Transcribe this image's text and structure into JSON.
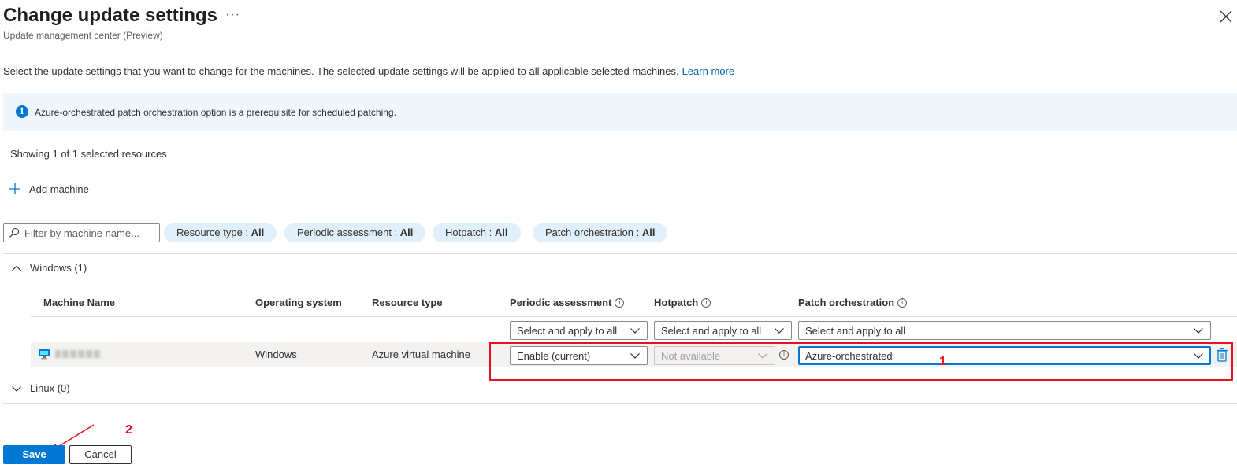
{
  "header": {
    "title": "Change update settings",
    "more": "···",
    "subtitle": "Update management center (Preview)",
    "close_icon": "close-icon"
  },
  "description": {
    "text": "Select the update settings that you want to change for the machines. The selected update settings will be applied to all applicable selected machines.",
    "link": "Learn more"
  },
  "info_bar": {
    "icon": "info-icon",
    "glyph": "i",
    "text": "Azure-orchestrated patch orchestration option is a prerequisite for scheduled patching."
  },
  "showing": "Showing 1 of 1 selected resources",
  "add_machine": {
    "icon": "plus-icon",
    "label": "Add machine"
  },
  "filter": {
    "placeholder": "Filter by machine name...",
    "pills": [
      {
        "label": "Resource type : ",
        "value": "All"
      },
      {
        "label": "Periodic assessment : ",
        "value": "All"
      },
      {
        "label": "Hotpatch : ",
        "value": "All"
      },
      {
        "label": "Patch orchestration : ",
        "value": "All"
      }
    ]
  },
  "groups": {
    "windows": "Windows (1)",
    "linux": "Linux (0)"
  },
  "columns": {
    "machine_name": "Machine Name",
    "os": "Operating system",
    "resource_type": "Resource type",
    "periodic_assessment": "Periodic assessment",
    "hotpatch": "Hotpatch",
    "patch_orchestration": "Patch orchestration",
    "info_glyph": "i"
  },
  "apply_all_row": {
    "machine_name": "-",
    "os": "-",
    "resource_type": "-",
    "periodic_assessment": "Select and apply to all",
    "hotpatch": "Select and apply to all",
    "patch_orchestration": "Select and apply to all"
  },
  "machine_row": {
    "icon": "virtual-machine-icon",
    "os": "Windows",
    "resource_type": "Azure virtual machine",
    "periodic_assessment": "Enable (current)",
    "hotpatch": "Not available",
    "patch_orchestration": "Azure-orchestrated",
    "delete_icon": "delete-icon"
  },
  "annotations": {
    "one": "1",
    "two": "2"
  },
  "footer": {
    "save": "Save",
    "cancel": "Cancel"
  },
  "colors": {
    "accent": "#0078d4",
    "info_bg": "#eff6fc",
    "pill_bg": "#e1effa",
    "annotation": "#e81123"
  }
}
